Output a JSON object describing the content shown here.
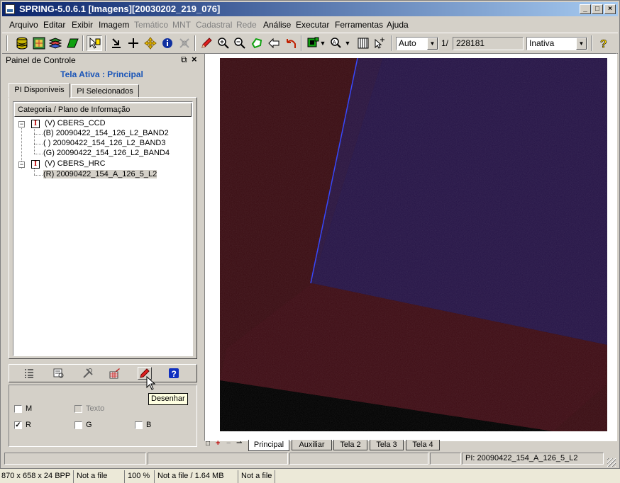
{
  "window": {
    "title": "SPRING-5.0.6.1 [Imagens][20030202_219_076]",
    "controls": {
      "minimize": "_",
      "maximize": "□",
      "close": "×"
    }
  },
  "menu": [
    {
      "label": "Arquivo",
      "enabled": true
    },
    {
      "label": "Editar",
      "enabled": true
    },
    {
      "label": "Exibir",
      "enabled": true
    },
    {
      "label": "Imagem",
      "enabled": true
    },
    {
      "label": "Temático",
      "enabled": false
    },
    {
      "label": "MNT",
      "enabled": false
    },
    {
      "label": "Cadastral",
      "enabled": false
    },
    {
      "label": "Rede",
      "enabled": false
    },
    {
      "label": "Análise",
      "enabled": true
    },
    {
      "label": "Executar",
      "enabled": true
    },
    {
      "label": "Ferramentas",
      "enabled": true
    },
    {
      "label": "Ajuda",
      "enabled": true
    }
  ],
  "toolbar": {
    "scale_mode": "Auto",
    "scale_prefix": "1/",
    "scale_value": "228181",
    "status_select": "Inativa",
    "icons": [
      "database-icon",
      "map-icon",
      "layers-icon",
      "green-shape-icon",
      "cursor-info-icon",
      "arrow-down-icon",
      "crosshair-icon",
      "pan-icon",
      "info-icon",
      "tool-icon",
      "pencil-icon",
      "zoom-in-icon",
      "zoom-out-icon",
      "zoom-area-icon",
      "back-arrow-icon",
      "undo-icon",
      "display-icon",
      "zoom-options-icon",
      "grid-icon",
      "cursor-plus-icon",
      "help-icon"
    ]
  },
  "panel": {
    "title": "Painel de Controle",
    "active_screen": "Tela Ativa : Principal",
    "tabs": [
      {
        "label": "PI Disponíveis",
        "active": true
      },
      {
        "label": "PI Selecionados",
        "active": false
      }
    ],
    "tree_header": "Categoria / Plano de Informação",
    "tree": [
      {
        "label": "(V) CBERS_CCD",
        "level": 0,
        "expander": "−"
      },
      {
        "label": "(B) 20090422_154_126_L2_BAND2",
        "level": 1
      },
      {
        "label": "( ) 20090422_154_126_L2_BAND3",
        "level": 1
      },
      {
        "label": "(G) 20090422_154_126_L2_BAND4",
        "level": 1
      },
      {
        "label": "(V) CBERS_HRC",
        "level": 0,
        "expander": "−"
      },
      {
        "label": "(R) 20090422_154_A_126_5_L2",
        "level": 1,
        "selected": true
      }
    ],
    "checkboxes": [
      {
        "label": "M",
        "checked": false,
        "enabled": true
      },
      {
        "label": "Texto",
        "checked": false,
        "enabled": false
      },
      {
        "label": "R",
        "checked": true,
        "enabled": true
      },
      {
        "label": "G",
        "checked": false,
        "enabled": true
      },
      {
        "label": "B",
        "checked": false,
        "enabled": true
      }
    ],
    "tooltip": "Desenhar"
  },
  "canvas_tabs": [
    {
      "label": "Principal",
      "active": true
    },
    {
      "label": "Auxiliar",
      "active": false
    },
    {
      "label": "Tela 2",
      "active": false
    },
    {
      "label": "Tela 3",
      "active": false
    },
    {
      "label": "Tela 4",
      "active": false
    }
  ],
  "canvas_tab_controls": [
    "□",
    "+",
    "−",
    "⇀"
  ],
  "status": {
    "pi": "PI: 20090422_154_A_126_5_L2"
  },
  "image_status": [
    {
      "text": "870 x 658 x 24 BPP"
    },
    {
      "text": "Not a file"
    },
    {
      "text": "100 %"
    },
    {
      "text": "Not a file / 1.64 MB"
    },
    {
      "text": "Not a file"
    }
  ],
  "colors": {
    "title_start": "#0a246a",
    "title_end": "#a6caf0",
    "active_screen": "#1a55b8",
    "face": "#d4d0c8"
  }
}
